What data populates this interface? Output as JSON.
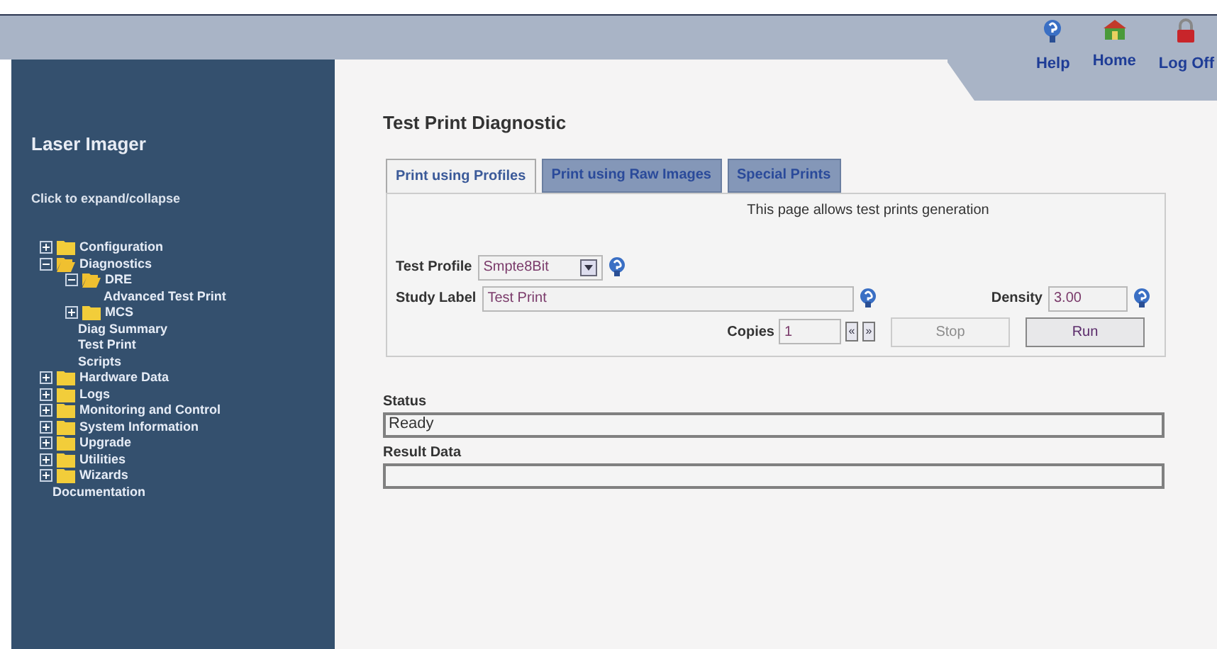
{
  "nav": [
    {
      "label": "Help",
      "kind": "help"
    },
    {
      "label": "Home",
      "kind": "home"
    },
    {
      "label": "Log Off",
      "kind": "logoff"
    }
  ],
  "sidebar": {
    "title": "Laser Imager",
    "hint": "Click to expand/collapse",
    "tree": [
      {
        "label": "Configuration",
        "expanded": false
      },
      {
        "label": "Diagnostics",
        "expanded": true,
        "children": [
          {
            "label": "DRE",
            "expanded": true,
            "children": [
              {
                "label": "Advanced Test Print"
              }
            ]
          },
          {
            "label": "MCS",
            "expanded": false
          },
          {
            "label": "Diag Summary"
          },
          {
            "label": "Test Print"
          },
          {
            "label": "Scripts"
          }
        ]
      },
      {
        "label": "Hardware Data",
        "expanded": false
      },
      {
        "label": "Logs",
        "expanded": false
      },
      {
        "label": "Monitoring and Control",
        "expanded": false
      },
      {
        "label": "System Information",
        "expanded": false
      },
      {
        "label": "Upgrade",
        "expanded": false
      },
      {
        "label": "Utilities",
        "expanded": false
      },
      {
        "label": "Wizards",
        "expanded": false
      },
      {
        "label": "Documentation"
      }
    ]
  },
  "page": {
    "title": "Test Print Diagnostic",
    "tabs": [
      {
        "label": "Print using Profiles",
        "selected": true
      },
      {
        "label": "Print using Raw Images",
        "selected": false
      },
      {
        "label": "Special Prints",
        "selected": false
      }
    ],
    "intro": "This page allows test prints generation",
    "test_profile": {
      "label": "Test Profile",
      "value": "Smpte8Bit"
    },
    "study_label": {
      "label": "Study Label",
      "value": "Test Print"
    },
    "density": {
      "label": "Density",
      "value": "3.00"
    },
    "copies": {
      "label": "Copies",
      "value": "1",
      "down": "«",
      "up": "»"
    },
    "buttons": [
      {
        "label": "Stop",
        "disabled": true
      },
      {
        "label": "Run",
        "disabled": false
      }
    ],
    "status": {
      "label": "Status",
      "value": "Ready"
    },
    "result": {
      "label": "Result Data"
    }
  }
}
